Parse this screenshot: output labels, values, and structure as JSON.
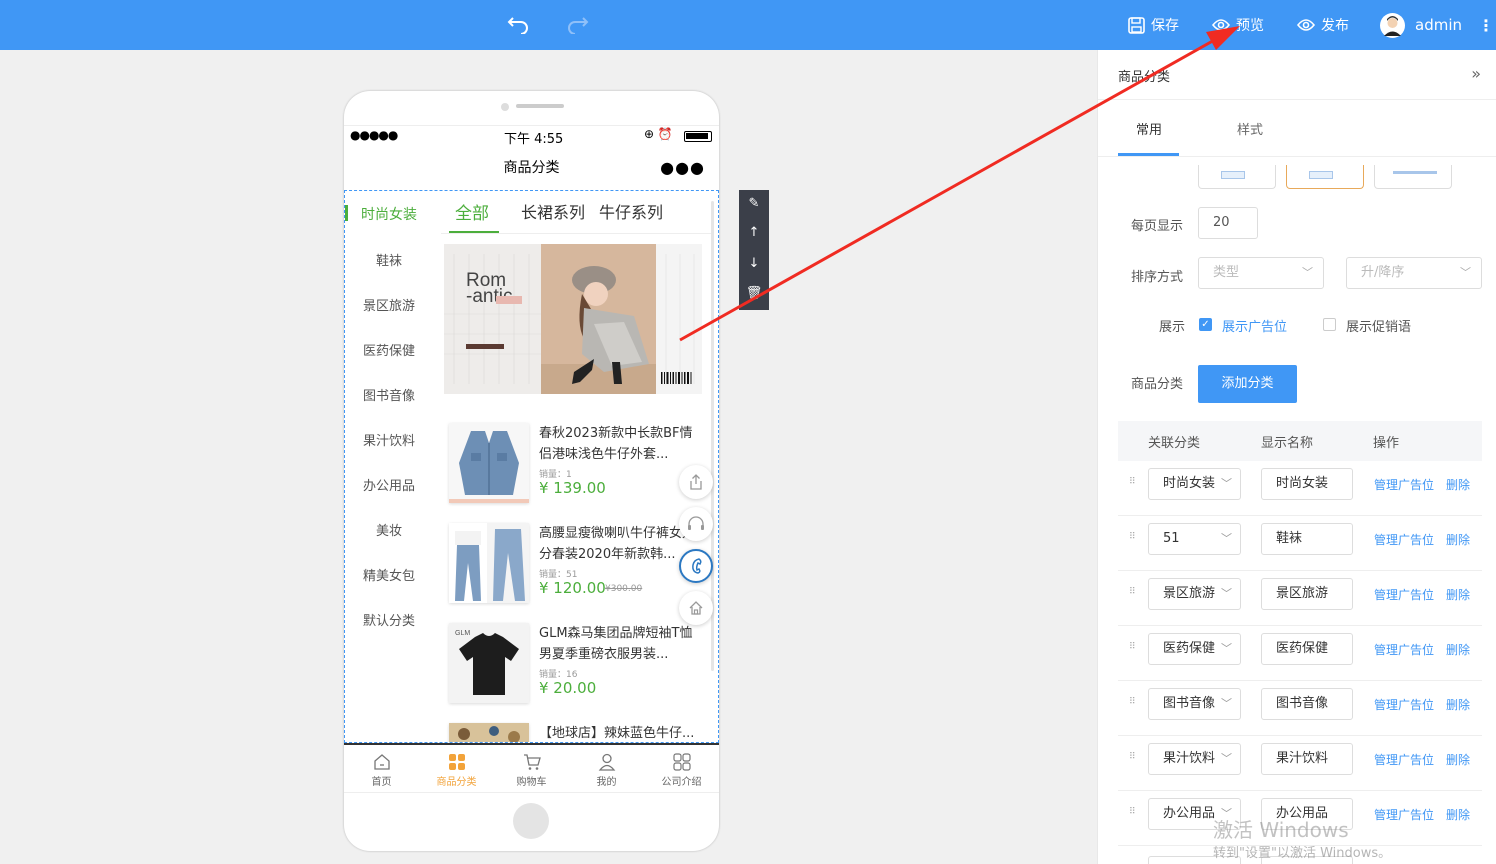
{
  "toolbar": {
    "save_label": "保存",
    "preview_label": "预览",
    "publish_label": "发布",
    "user_name": "admin"
  },
  "phone": {
    "status_time": "下午 4:55",
    "nav_title": "商品分类",
    "left_categories": [
      "时尚女装",
      "鞋袜",
      "景区旅游",
      "医药保健",
      "图书音像",
      "果汁饮料",
      "办公用品",
      "美妆",
      "精美女包",
      "默认分类"
    ],
    "tabs": [
      "全部",
      "长裙系列",
      "牛仔系列"
    ],
    "banner_text": "Rom\n-antic",
    "products": [
      {
        "name": "春秋2023新款中长款BF情侣港味浅色牛仔外套...",
        "sales": "销量：1",
        "price": "¥ 139.00",
        "old_price": ""
      },
      {
        "name": "高腰显瘦微喇叭牛仔裤女九分春装2020年新款韩...",
        "sales": "销量：51",
        "price": "¥ 120.00",
        "old_price": "¥300.00"
      },
      {
        "name": "GLM森马集团品牌短袖T恤男夏季重磅衣服男装...",
        "sales": "销量：16",
        "price": "¥ 20.00",
        "old_price": ""
      },
      {
        "name": "【地球店】辣妹蓝色牛仔..."
      }
    ],
    "tabbar": [
      "首页",
      "商品分类",
      "购物车",
      "我的",
      "公司介绍"
    ]
  },
  "panel": {
    "title": "商品分类",
    "tabs": [
      "常用",
      "样式"
    ],
    "per_page_label": "每页显示",
    "per_page_value": "20",
    "sort_label": "排序方式",
    "sort_type_placeholder": "类型",
    "sort_order_placeholder": "升/降序",
    "display_label": "展示",
    "show_ad_label": "展示广告位",
    "show_promo_label": "展示促销语",
    "category_label": "商品分类",
    "add_button": "添加分类",
    "table_headers": [
      "关联分类",
      "显示名称",
      "操作"
    ],
    "rows": [
      {
        "linked": "时尚女装",
        "name": "时尚女装"
      },
      {
        "linked": "51",
        "name": "鞋袜"
      },
      {
        "linked": "景区旅游",
        "name": "景区旅游"
      },
      {
        "linked": "医药保健",
        "name": "医药保健"
      },
      {
        "linked": "图书音像",
        "name": "图书音像"
      },
      {
        "linked": "果汁饮料",
        "name": "果汁饮料"
      },
      {
        "linked": "办公用品",
        "name": "办公用品"
      }
    ],
    "manage_label": "管理广告位",
    "delete_label": "删除"
  },
  "watermark": {
    "line1": "激活 Windows",
    "line2": "转到\"设置\"以激活 Windows。"
  },
  "colors": {
    "topbar": "#4097f5",
    "accent_green": "#4cae3c",
    "accent_orange": "#f2a33a",
    "arrow_red": "#f02b22"
  }
}
